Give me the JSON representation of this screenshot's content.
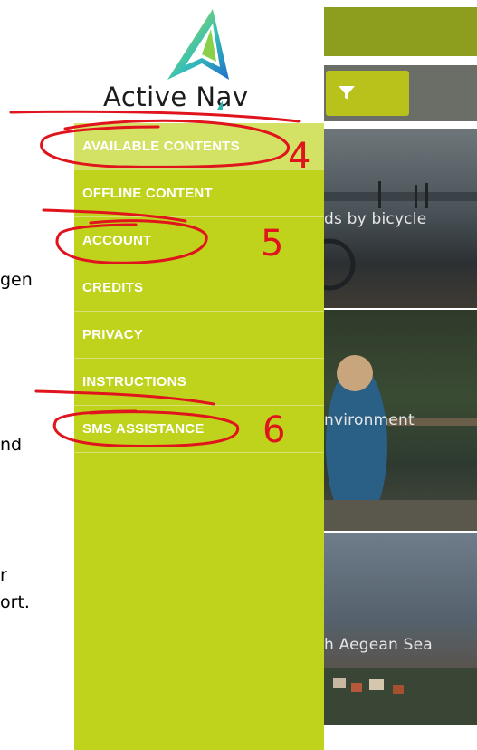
{
  "doc_fragments": [
    "gen",
    "nd",
    "r",
    "ort."
  ],
  "app": {
    "cards": [
      {
        "title": "ds by bicycle"
      },
      {
        "title": "nvironment"
      },
      {
        "title": "h Aegean Sea"
      }
    ],
    "filter_icon": "filter-funnel-icon"
  },
  "drawer": {
    "logo_text": "Active Nav",
    "menu": [
      {
        "label": "AVAILABLE CONTENTS"
      },
      {
        "label": "OFFLINE CONTENT"
      },
      {
        "label": "ACCOUNT"
      },
      {
        "label": "CREDITS"
      },
      {
        "label": "PRIVACY"
      },
      {
        "label": "INSTRUCTIONS"
      },
      {
        "label": "SMS ASSISTANCE"
      }
    ]
  },
  "annotations": [
    "4",
    "5",
    "6"
  ],
  "colors": {
    "drawer_bg": "#c0d31c",
    "active_item_bg": "#d3e264",
    "topbar": "#8d9d1d",
    "filter_button": "#b8c21a",
    "annotation_red": "#e0141c"
  }
}
